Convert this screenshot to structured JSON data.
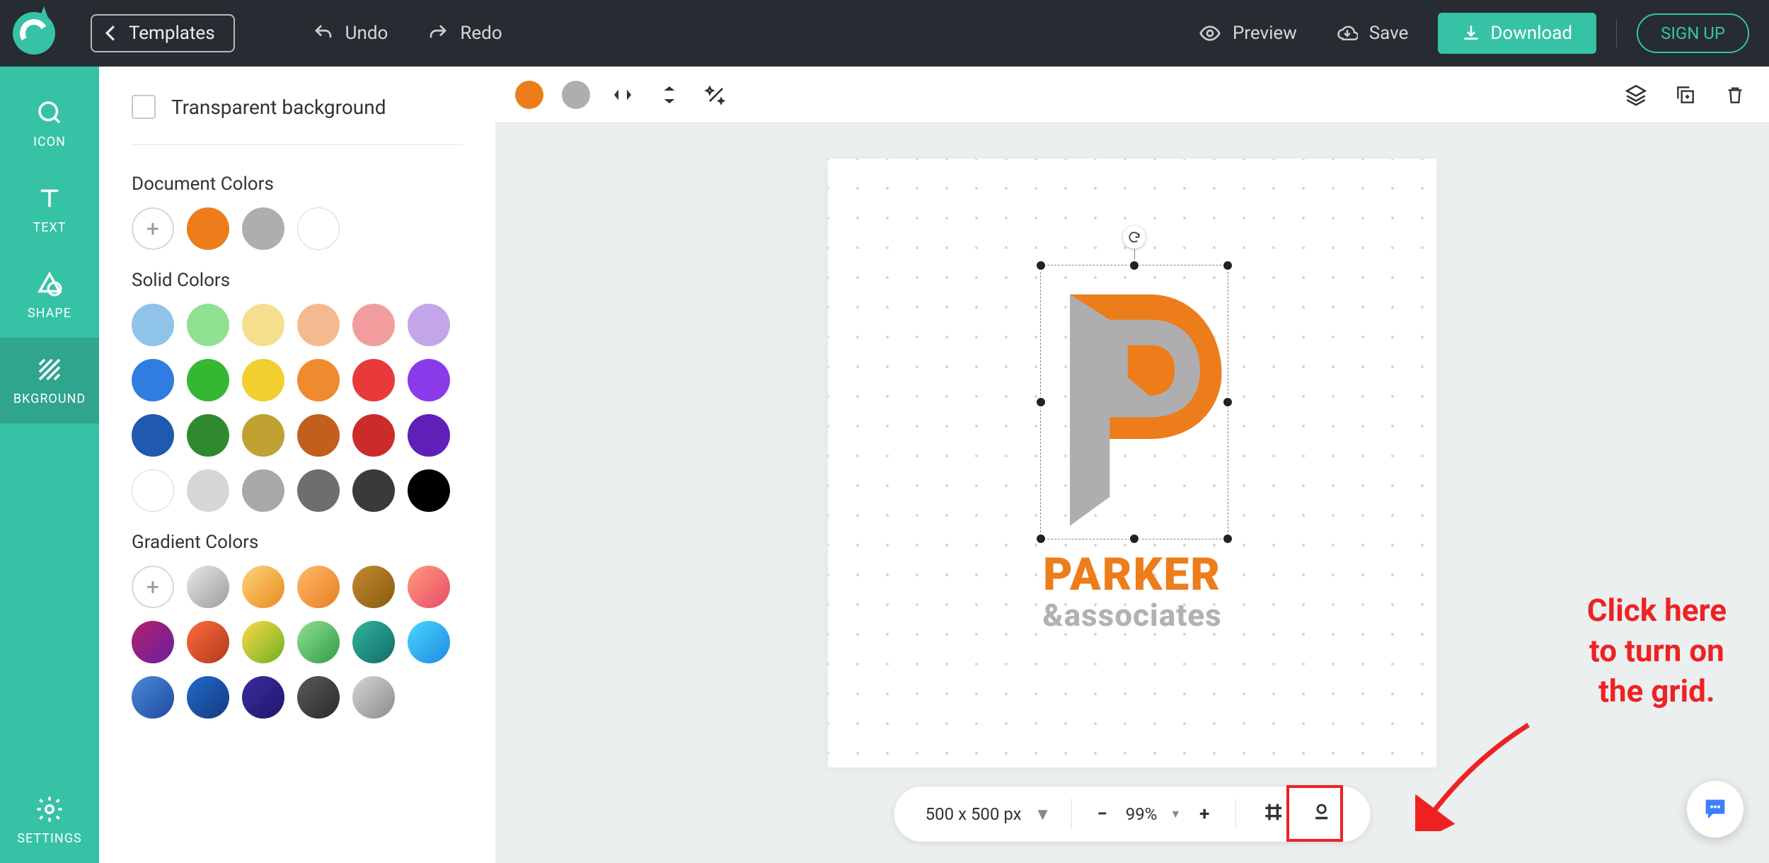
{
  "header": {
    "templates_label": "Templates",
    "undo_label": "Undo",
    "redo_label": "Redo",
    "preview_label": "Preview",
    "save_label": "Save",
    "download_label": "Download",
    "signup_label": "SIGN UP"
  },
  "rail": {
    "items": [
      {
        "label": "ICON"
      },
      {
        "label": "TEXT"
      },
      {
        "label": "SHAPE"
      },
      {
        "label": "BKGROUND"
      },
      {
        "label": "SETTINGS"
      }
    ]
  },
  "panel": {
    "transparent_label": "Transparent background",
    "doc_colors_title": "Document Colors",
    "doc_colors": [
      "#ed7d1a",
      "#aeaeb1",
      "#ffffff"
    ],
    "solid_title": "Solid Colors",
    "solid_colors": [
      "#8fc3e8",
      "#8fe08f",
      "#f5df8f",
      "#f5b98f",
      "#f29d9d",
      "#c3a6e8",
      "#2f7de0",
      "#34b834",
      "#f0cf2f",
      "#f08a2f",
      "#e83a3a",
      "#8a3ae8",
      "#1f59b0",
      "#2f8a2f",
      "#bfa031",
      "#c25f1f",
      "#cc2b2b",
      "#5f1fb8",
      "#ffffff",
      "#d6d6d6",
      "#a8a8a8",
      "#6e6e6e",
      "#3a3a3a",
      "#000000"
    ],
    "gradient_title": "Gradient Colors",
    "gradient_colors": [
      [
        "#e8e8e8",
        "#9c9c9c"
      ],
      [
        "#ffd37a",
        "#e88c1f"
      ],
      [
        "#ffb96b",
        "#e87d1f"
      ],
      [
        "#c48a2f",
        "#8a5a10"
      ],
      [
        "#ff9c7a",
        "#e84a6b"
      ],
      [
        "#b0226b",
        "#6b1fa0"
      ],
      [
        "#ff6b3a",
        "#b03a1f"
      ],
      [
        "#ffd94a",
        "#6bb01f"
      ],
      [
        "#8fe08f",
        "#2f9c4a"
      ],
      [
        "#2fb59c",
        "#156b6b"
      ],
      [
        "#4ad6ff",
        "#1f8ae0"
      ],
      [
        "#4a8ad6",
        "#1f4aa0"
      ],
      [
        "#1f6bcc",
        "#153a80"
      ],
      [
        "#3a2fa0",
        "#1f156b"
      ],
      [
        "#5a5a5a",
        "#2a2a2a"
      ],
      [
        "#d6d6d6",
        "#8a8a8a"
      ]
    ]
  },
  "toolbar": {
    "fill1": "#ed7d1a",
    "fill2": "#aeaeb1"
  },
  "canvas": {
    "logo_line1": "PARKER",
    "logo_line2": "&associates"
  },
  "status": {
    "size_label": "500 x 500 px",
    "zoom_label": "99%"
  },
  "annotation": {
    "line1": "Click here",
    "line2": "to turn on",
    "line3": "the grid."
  }
}
